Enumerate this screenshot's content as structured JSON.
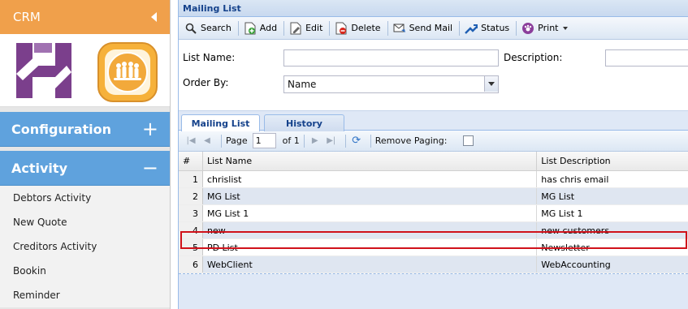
{
  "sidebar": {
    "title": "CRM",
    "sections": [
      {
        "label": "Configuration",
        "sign": "+"
      },
      {
        "label": "Activity",
        "sign": "−"
      }
    ],
    "menu_items": [
      "Debtors Activity",
      "New Quote",
      "Creditors Activity",
      "Bookin",
      "Reminder"
    ]
  },
  "panel": {
    "title": "Mailing List",
    "toolbar": {
      "search": "Search",
      "add": "Add",
      "edit": "Edit",
      "delete": "Delete",
      "send_mail": "Send Mail",
      "status": "Status",
      "print": "Print"
    },
    "form": {
      "list_name_label": "List Name:",
      "list_name_value": "",
      "description_label": "Description:",
      "description_value": "",
      "order_by_label": "Order By:",
      "order_by_value": "Name"
    },
    "tabs": [
      "Mailing List",
      "History"
    ],
    "pager": {
      "page_label": "Page",
      "page_value": "1",
      "of_label": "of 1",
      "remove_paging_label": "Remove Paging:"
    },
    "grid": {
      "columns": [
        "#",
        "List Name",
        "List Description"
      ],
      "rows": [
        {
          "num": "1",
          "name": "chrislist",
          "desc": "has chris email"
        },
        {
          "num": "2",
          "name": "MG List",
          "desc": "MG List"
        },
        {
          "num": "3",
          "name": "MG List 1",
          "desc": "MG List 1"
        },
        {
          "num": "4",
          "name": "new",
          "desc": "new customers"
        },
        {
          "num": "5",
          "name": "PD List",
          "desc": "Newsletter"
        },
        {
          "num": "6",
          "name": "WebClient",
          "desc": "WebAccounting"
        }
      ]
    }
  },
  "colors": {
    "header_orange": "#f0a04b",
    "section_blue": "#5fa2dd",
    "highlight_red": "#d0121b",
    "title_blue": "#15428b"
  }
}
